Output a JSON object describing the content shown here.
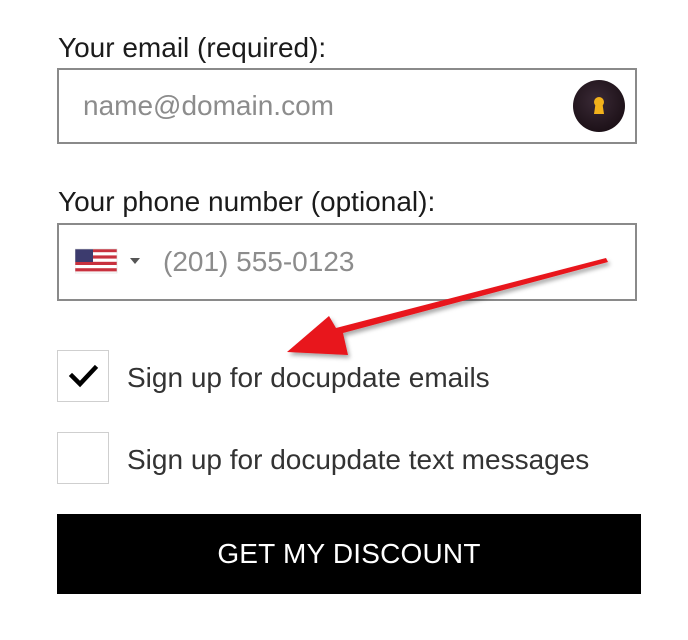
{
  "form": {
    "email_label": "Your email (required):",
    "email_placeholder": "name@domain.com",
    "email_value": "",
    "phone_label": "Your phone number (optional):",
    "phone_placeholder": "(201) 555-0123",
    "phone_value": "",
    "phone_country": "United States",
    "email_optin_label": "Sign up for docupdate emails",
    "email_optin_checked": true,
    "sms_optin_label": "Sign up for docupdate text messages",
    "sms_optin_checked": false,
    "submit_label": "GET MY DISCOUNT"
  },
  "icons": {
    "password_manager": "keyhole-icon",
    "country_flag": "us-flag-icon",
    "dropdown": "caret-down-icon",
    "checkmark": "checkmark-icon",
    "annotation": "red-arrow"
  },
  "colors": {
    "button_bg": "#000000",
    "button_text": "#ffffff",
    "field_border": "#8a8a8a",
    "arrow": "#e8141c",
    "keyhole": "#f2b21b"
  }
}
